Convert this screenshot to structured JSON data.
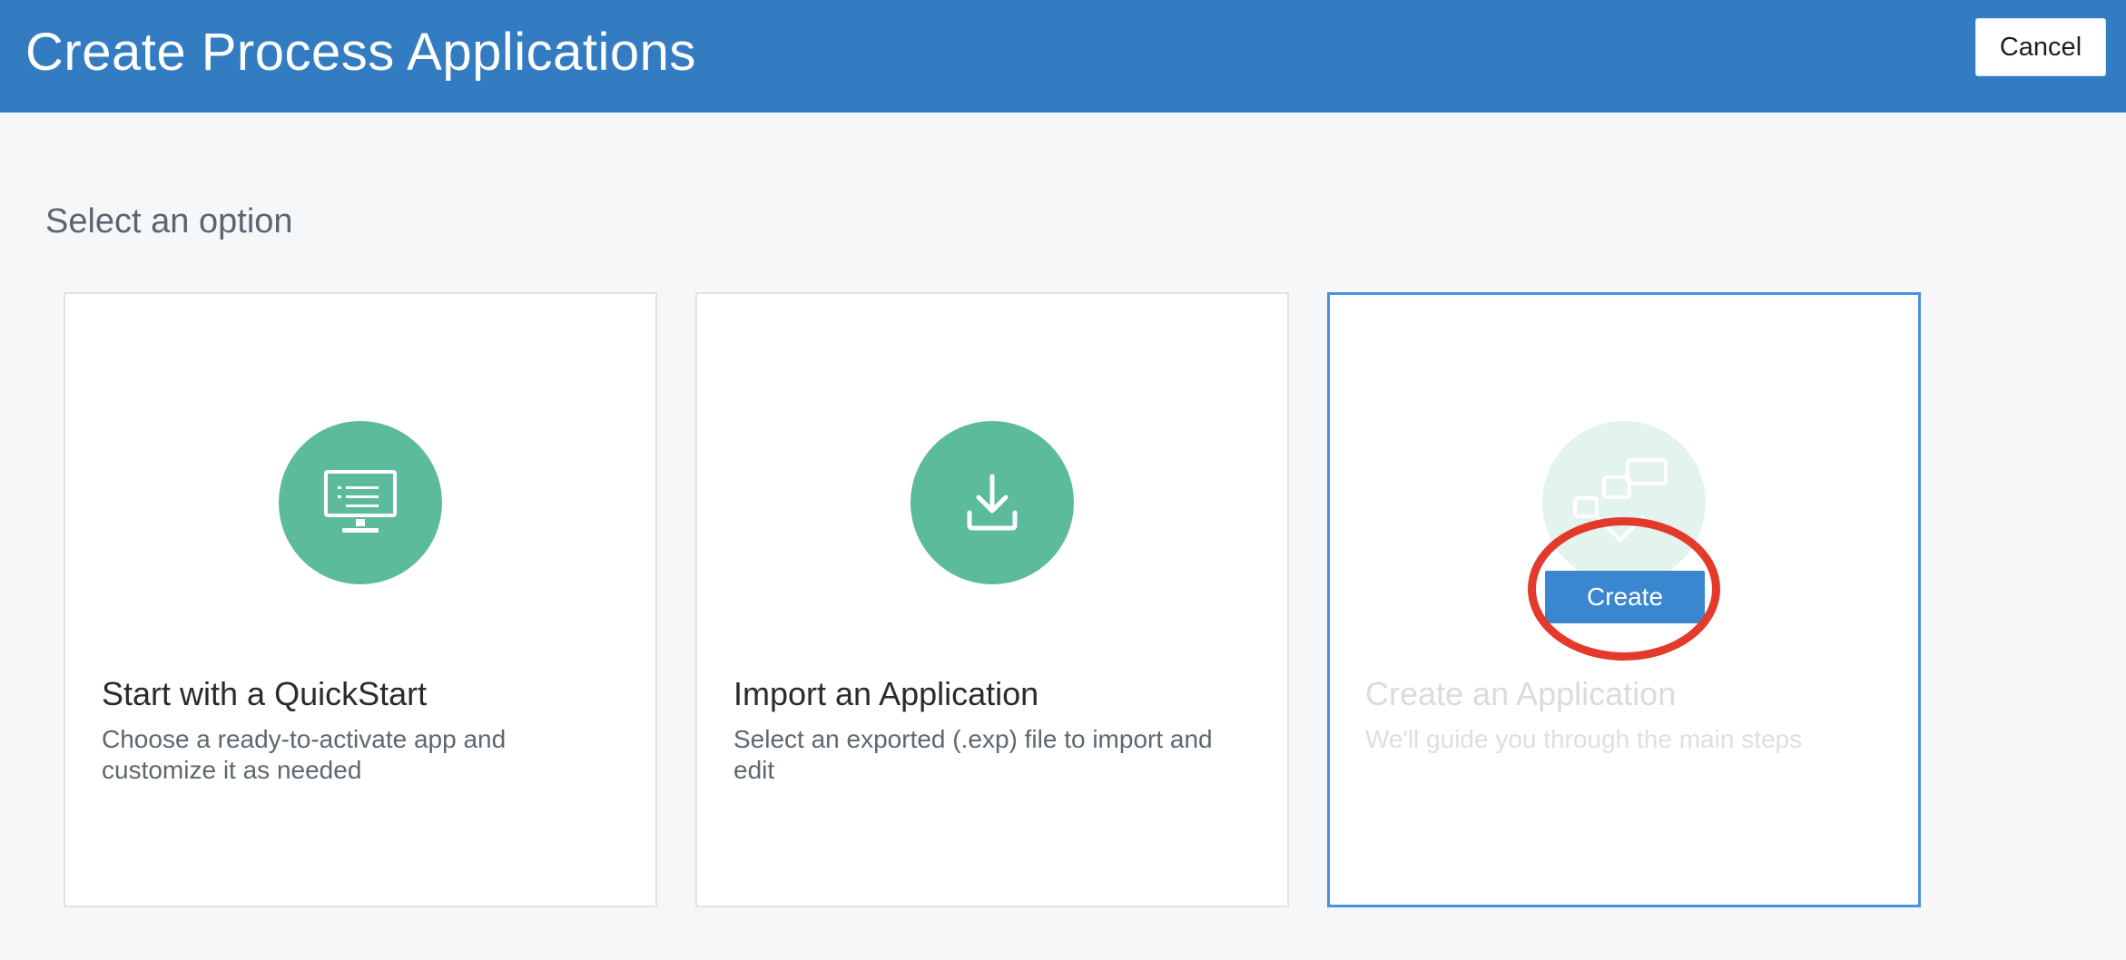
{
  "header": {
    "title": "Create Process Applications",
    "cancel_label": "Cancel",
    "background_color": "#337cc2"
  },
  "main": {
    "section_heading": "Select an option",
    "cards": [
      {
        "title": "Start with a QuickStart",
        "description": "Choose a ready-to-activate app and customize it as needed",
        "icon": "monitor-icon",
        "selected": false
      },
      {
        "title": "Import an Application",
        "description": "Select an exported (.exp) file to import and edit",
        "icon": "download-icon",
        "selected": false
      },
      {
        "title": "Create an Application",
        "description": "We'll guide you through the main steps",
        "icon": "diagram-icon",
        "selected": true,
        "action_label": "Create"
      }
    ]
  },
  "colors": {
    "accent": "#3a86cf",
    "icon_circle": "#5cba9d",
    "selected_border": "#4a90e2",
    "annotation_ring": "#e43a2b"
  }
}
